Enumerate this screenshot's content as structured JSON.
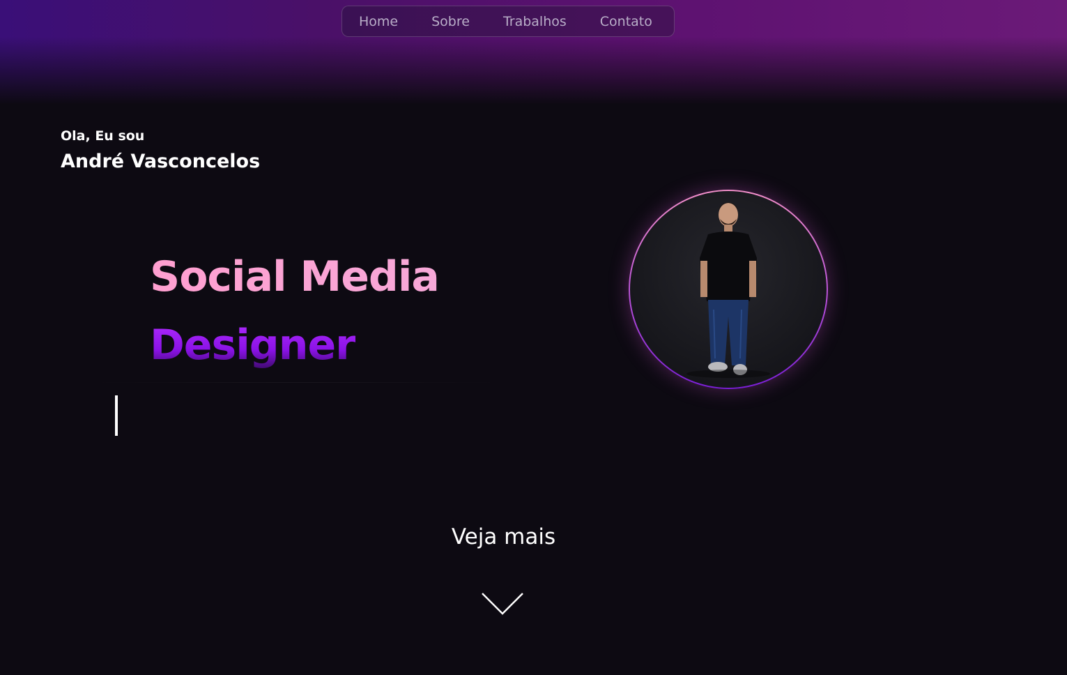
{
  "nav": {
    "items": [
      {
        "label": "Home"
      },
      {
        "label": "Sobre"
      },
      {
        "label": "Trabalhos"
      },
      {
        "label": "Contato"
      }
    ]
  },
  "hero": {
    "greeting": "Ola, Eu sou",
    "name": "André Vasconcelos",
    "role_line_1": "Social Media",
    "role_line_2": "Designer"
  },
  "see_more": {
    "label": "Veja mais",
    "icon": "chevron-down-icon"
  },
  "colors": {
    "background": "#0d0a12",
    "accent_pink": "#f7a6d2",
    "accent_purple": "#9a1ee8",
    "nav_text": "#b9aec8"
  }
}
